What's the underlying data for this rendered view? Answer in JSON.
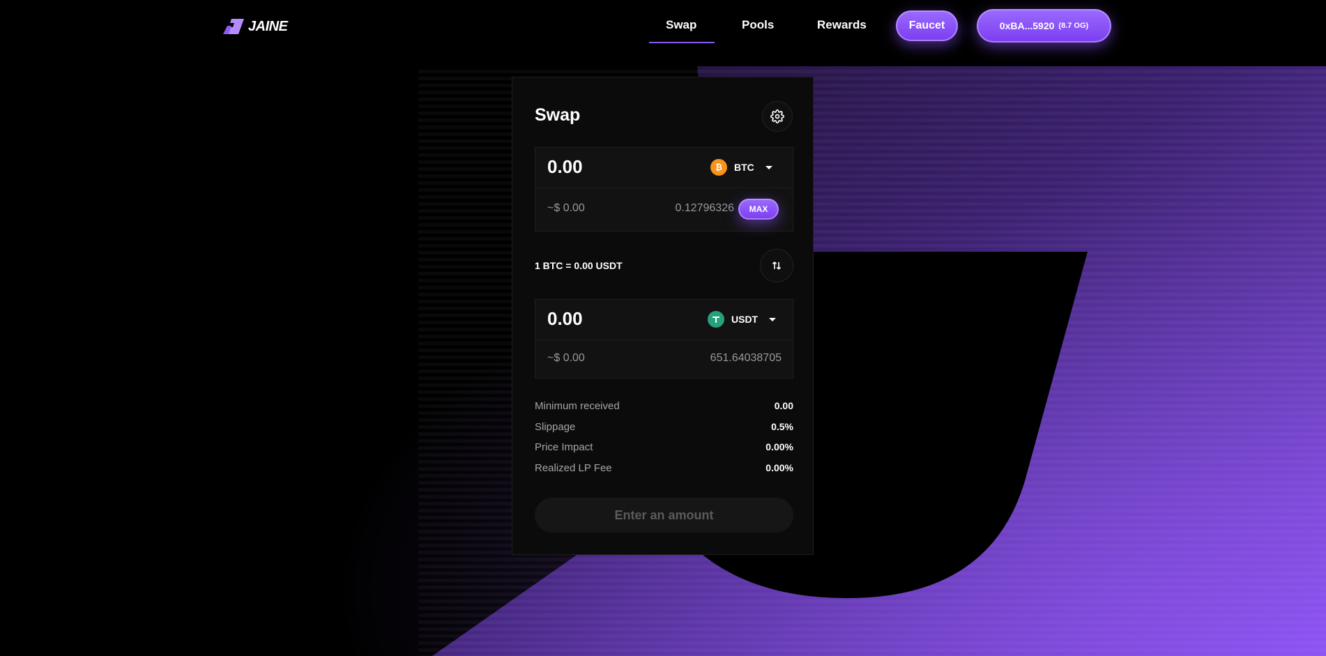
{
  "brand": {
    "name": "JAINE"
  },
  "nav": {
    "swap": "Swap",
    "pools": "Pools",
    "rewards": "Rewards",
    "faucet": "Faucet",
    "wallet_address": "0xBA...5920",
    "wallet_balance": "(8.7 OG)"
  },
  "swap": {
    "title": "Swap",
    "from": {
      "amount": "0.00",
      "token": "BTC",
      "token_icon": "bitcoin-icon",
      "usd": "~$ 0.00",
      "balance": "0.12796326",
      "max_label": "MAX"
    },
    "rate": "1 BTC = 0.00 USDT",
    "to": {
      "amount": "0.00",
      "token": "USDT",
      "token_icon": "tether-icon",
      "usd": "~$ 0.00",
      "balance": "651.64038705"
    },
    "details": [
      {
        "label": "Minimum received",
        "value": "0.00"
      },
      {
        "label": "Slippage",
        "value": "0.5%"
      },
      {
        "label": "Price Impact",
        "value": "0.00%"
      },
      {
        "label": "Realized LP Fee",
        "value": "0.00%"
      }
    ],
    "submit_label": "Enter an amount"
  },
  "colors": {
    "accent": "#8a5cf0",
    "btc": "#f7931a",
    "usdt": "#26a17b"
  }
}
